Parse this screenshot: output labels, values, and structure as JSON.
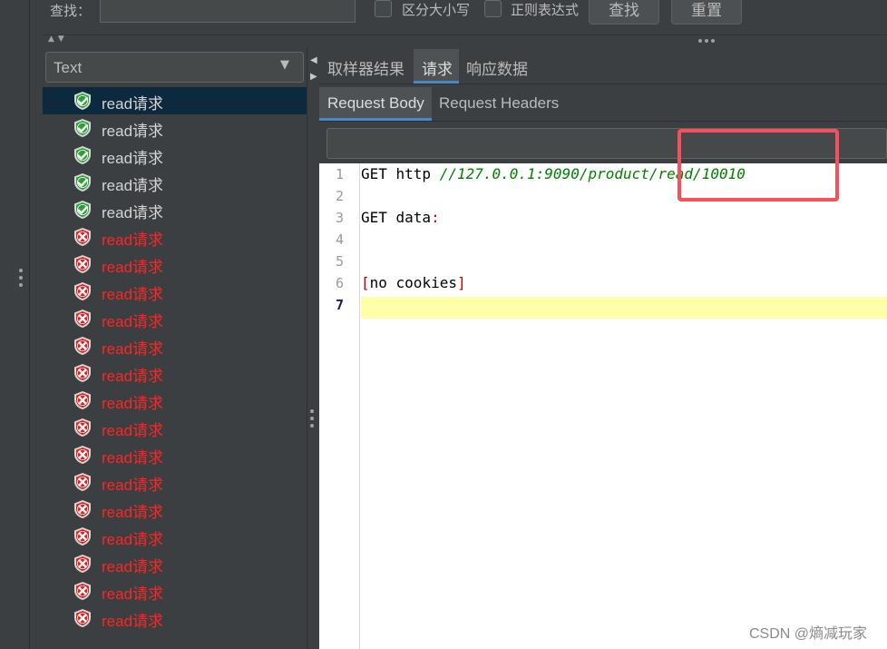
{
  "search": {
    "label": "查找：",
    "value": "",
    "case_label": "区分大小写",
    "regex_label": "正则表达式",
    "find_label": "查找",
    "reset_label": "重置"
  },
  "renderer": {
    "selected": "Text"
  },
  "tree": {
    "items": [
      {
        "label": "read请求",
        "status": "success"
      },
      {
        "label": "read请求",
        "status": "success"
      },
      {
        "label": "read请求",
        "status": "success"
      },
      {
        "label": "read请求",
        "status": "success"
      },
      {
        "label": "read请求",
        "status": "success"
      },
      {
        "label": "read请求",
        "status": "error"
      },
      {
        "label": "read请求",
        "status": "error"
      },
      {
        "label": "read请求",
        "status": "error"
      },
      {
        "label": "read请求",
        "status": "error"
      },
      {
        "label": "read请求",
        "status": "error"
      },
      {
        "label": "read请求",
        "status": "error"
      },
      {
        "label": "read请求",
        "status": "error"
      },
      {
        "label": "read请求",
        "status": "error"
      },
      {
        "label": "read请求",
        "status": "error"
      },
      {
        "label": "read请求",
        "status": "error"
      },
      {
        "label": "read请求",
        "status": "error"
      },
      {
        "label": "read请求",
        "status": "error"
      },
      {
        "label": "read请求",
        "status": "error"
      },
      {
        "label": "read请求",
        "status": "error"
      },
      {
        "label": "read请求",
        "status": "error"
      }
    ],
    "selected_index": 0
  },
  "tabs": {
    "sampler_result": "取样器结果",
    "request": "请求",
    "response_data": "响应数据",
    "active": "请求"
  },
  "subtabs": {
    "body": "Request Body",
    "headers": "Request Headers",
    "active": "Request Body"
  },
  "editor": {
    "search_value": "",
    "line_numbers": [
      "1",
      "2",
      "3",
      "4",
      "5",
      "6",
      "7"
    ],
    "current_line": "7",
    "line1_method": "GET http",
    "line1_url": "//127.0.0.1:9090/product/read/10010",
    "line3": "GET data",
    "line3_trail": ":",
    "line6_open": "[",
    "line6_text": "no cookies",
    "line6_close": "]"
  },
  "watermark": "CSDN @熵减玩家",
  "colors": {
    "background": "#3c3f41",
    "accent": "#4a88c7",
    "success": "#2e9e3a",
    "error": "#e02020",
    "error_text": "#ff2424",
    "highlight_box": "#f6505d"
  }
}
